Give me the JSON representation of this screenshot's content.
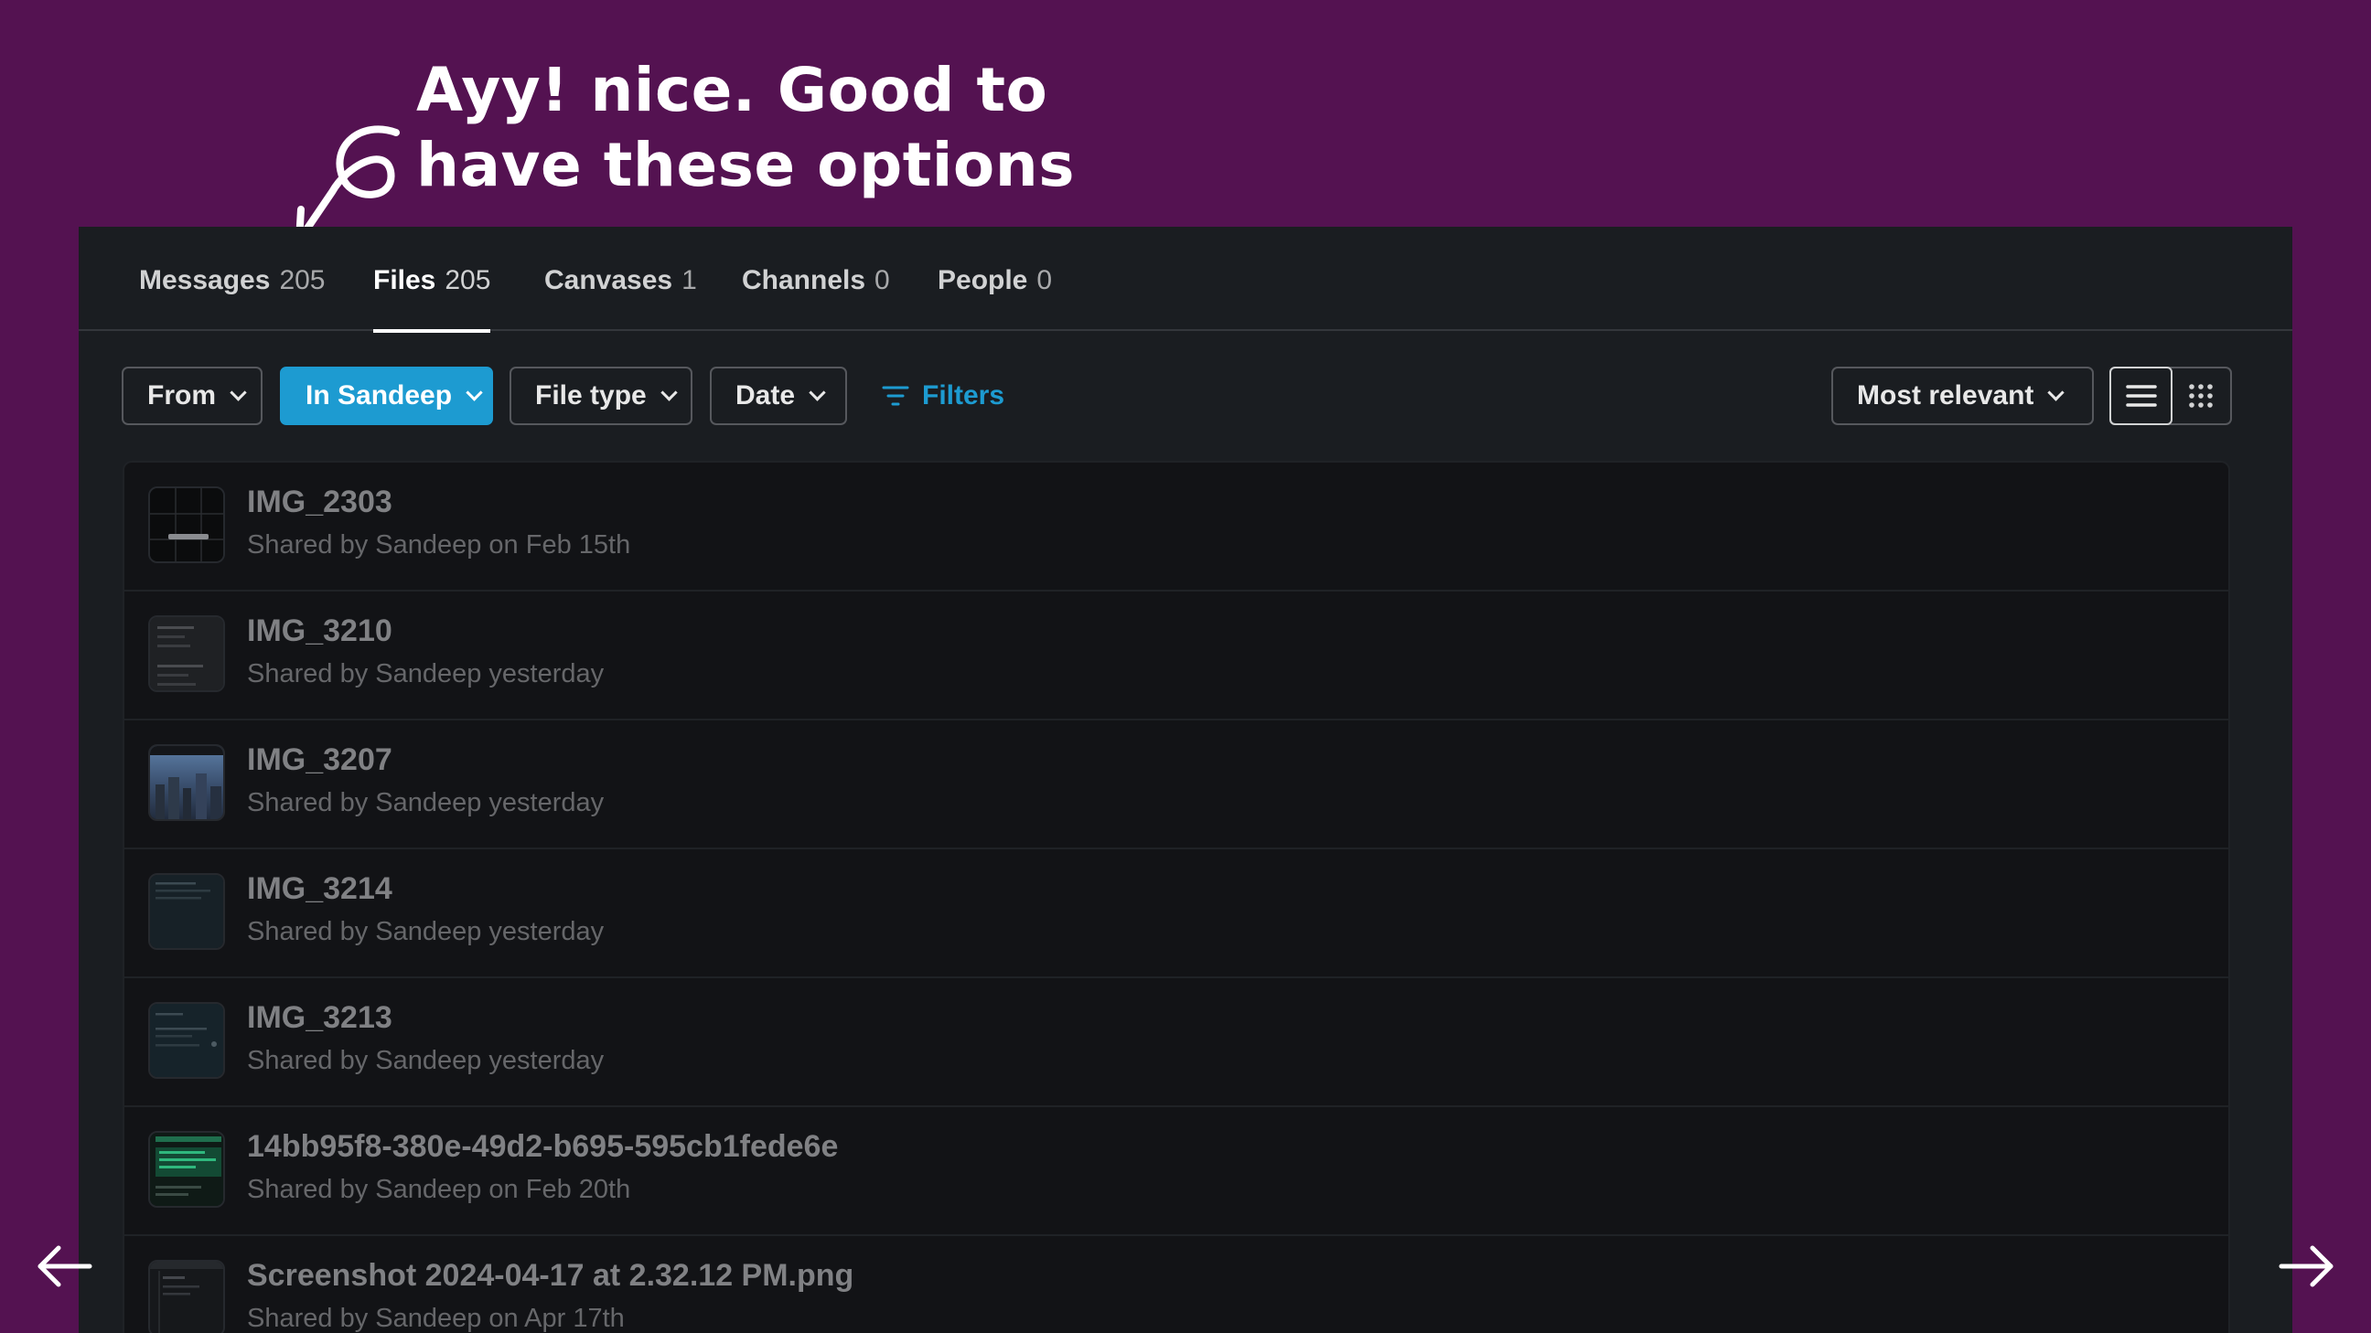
{
  "annotation": {
    "line1": "Ayy! nice. Good to",
    "line2": "have these options"
  },
  "tabs": [
    {
      "label": "Messages",
      "count": "205",
      "active": false
    },
    {
      "label": "Files",
      "count": "205",
      "active": true
    },
    {
      "label": "Canvases",
      "count": "1",
      "active": false
    },
    {
      "label": "Channels",
      "count": "0",
      "active": false
    },
    {
      "label": "People",
      "count": "0",
      "active": false
    }
  ],
  "filters": {
    "from": "From",
    "in": "In Sandeep",
    "file_type": "File type",
    "date": "Date",
    "filters_link": "Filters",
    "sort": "Most relevant"
  },
  "view": {
    "list_icon": "list-view-icon",
    "grid_icon": "grid-view-icon",
    "selected": "list"
  },
  "results": [
    {
      "name": "IMG_2303",
      "meta": "Shared by Sandeep on Feb 15th",
      "thumb": "dark-grid"
    },
    {
      "name": "IMG_3210",
      "meta": "Shared by Sandeep yesterday",
      "thumb": "dark-text"
    },
    {
      "name": "IMG_3207",
      "meta": "Shared by Sandeep yesterday",
      "thumb": "city-photo"
    },
    {
      "name": "IMG_3214",
      "meta": "Shared by Sandeep yesterday",
      "thumb": "dark-teal"
    },
    {
      "name": "IMG_3213",
      "meta": "Shared by Sandeep yesterday",
      "thumb": "dark-teal-text"
    },
    {
      "name": "14bb95f8-380e-49d2-b695-595cb1fede6e",
      "meta": "Shared by Sandeep on Feb 20th",
      "thumb": "green-terminal"
    },
    {
      "name": "Screenshot 2024-04-17 at 2.32.12 PM.png",
      "meta": "Shared by Sandeep on Apr 17th",
      "thumb": "dark-screenshot"
    }
  ],
  "nav": {
    "prev_icon": "arrow-left-icon",
    "next_icon": "arrow-right-icon"
  },
  "colors": {
    "background": "#541251",
    "panel": "#1a1d21",
    "accent": "#1d9bd1"
  }
}
